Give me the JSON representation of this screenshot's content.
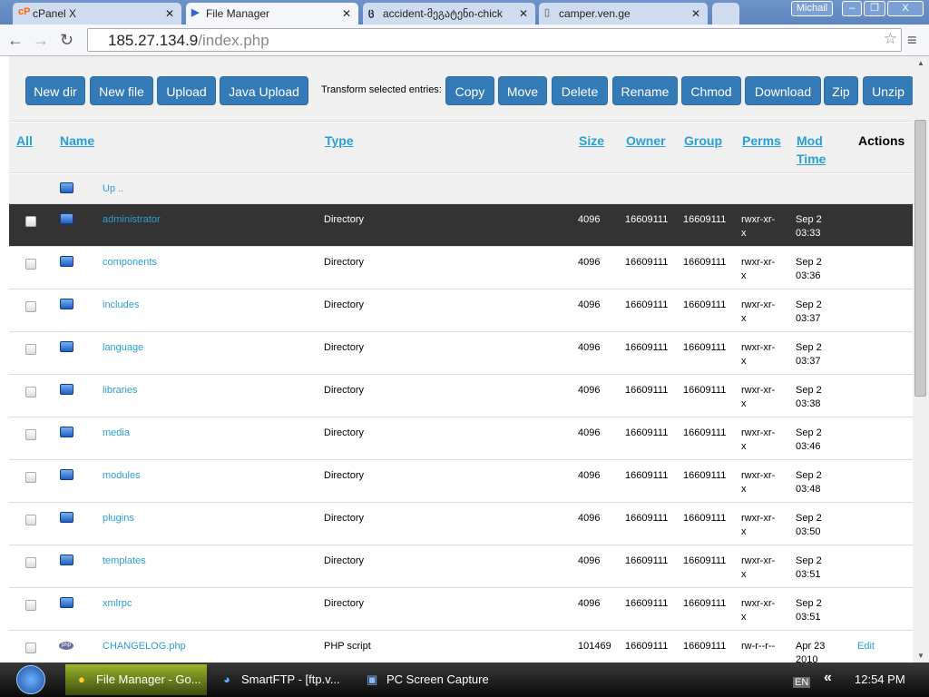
{
  "browser": {
    "tabs": [
      {
        "label": "cPanel X",
        "icon": "cP"
      },
      {
        "label": "File Manager",
        "icon": "▶"
      },
      {
        "label": "accident-მეგატენი-chick",
        "icon": "ც"
      },
      {
        "label": "camper.ven.ge",
        "icon": "▯"
      }
    ],
    "user": "Michail",
    "url_host": "185.27.134.9",
    "url_path": "/index.php"
  },
  "toolbar": {
    "buttons": [
      "New dir",
      "New file",
      "Upload",
      "Java Upload"
    ],
    "transform_label": "Transform selected entries:",
    "actions": [
      "Copy",
      "Move",
      "Delete",
      "Rename",
      "Chmod",
      "Download",
      "Zip",
      "Unzip"
    ]
  },
  "headers": {
    "all": "All",
    "name": "Name",
    "type": "Type",
    "size": "Size",
    "owner": "Owner",
    "group": "Group",
    "perms": "Perms",
    "mod1": "Mod",
    "mod2": "Time",
    "actions": "Actions"
  },
  "up": "Up ..",
  "rows": [
    {
      "name": "administrator",
      "type": "Directory",
      "size": "4096",
      "owner": "16609111",
      "group": "16609111",
      "perms1": "rwxr-xr-",
      "perms2": "x",
      "date": "Sep 2",
      "time": "03:33",
      "action": ""
    },
    {
      "name": "components",
      "type": "Directory",
      "size": "4096",
      "owner": "16609111",
      "group": "16609111",
      "perms1": "rwxr-xr-",
      "perms2": "x",
      "date": "Sep 2",
      "time": "03:36",
      "action": ""
    },
    {
      "name": "includes",
      "type": "Directory",
      "size": "4096",
      "owner": "16609111",
      "group": "16609111",
      "perms1": "rwxr-xr-",
      "perms2": "x",
      "date": "Sep 2",
      "time": "03:37",
      "action": ""
    },
    {
      "name": "language",
      "type": "Directory",
      "size": "4096",
      "owner": "16609111",
      "group": "16609111",
      "perms1": "rwxr-xr-",
      "perms2": "x",
      "date": "Sep 2",
      "time": "03:37",
      "action": ""
    },
    {
      "name": "libraries",
      "type": "Directory",
      "size": "4096",
      "owner": "16609111",
      "group": "16609111",
      "perms1": "rwxr-xr-",
      "perms2": "x",
      "date": "Sep 2",
      "time": "03:38",
      "action": ""
    },
    {
      "name": "media",
      "type": "Directory",
      "size": "4096",
      "owner": "16609111",
      "group": "16609111",
      "perms1": "rwxr-xr-",
      "perms2": "x",
      "date": "Sep 2",
      "time": "03:46",
      "action": ""
    },
    {
      "name": "modules",
      "type": "Directory",
      "size": "4096",
      "owner": "16609111",
      "group": "16609111",
      "perms1": "rwxr-xr-",
      "perms2": "x",
      "date": "Sep 2",
      "time": "03:48",
      "action": ""
    },
    {
      "name": "plugins",
      "type": "Directory",
      "size": "4096",
      "owner": "16609111",
      "group": "16609111",
      "perms1": "rwxr-xr-",
      "perms2": "x",
      "date": "Sep 2",
      "time": "03:50",
      "action": ""
    },
    {
      "name": "templates",
      "type": "Directory",
      "size": "4096",
      "owner": "16609111",
      "group": "16609111",
      "perms1": "rwxr-xr-",
      "perms2": "x",
      "date": "Sep 2",
      "time": "03:51",
      "action": ""
    },
    {
      "name": "xmlrpc",
      "type": "Directory",
      "size": "4096",
      "owner": "16609111",
      "group": "16609111",
      "perms1": "rwxr-xr-",
      "perms2": "x",
      "date": "Sep 2",
      "time": "03:51",
      "action": ""
    },
    {
      "name": "CHANGELOG.php",
      "type": "PHP script",
      "size": "101469",
      "owner": "16609111",
      "group": "16609111",
      "perms1": "rw-r--r--",
      "perms2": "",
      "date": "Apr 23",
      "time": "2010",
      "action": "Edit"
    }
  ],
  "taskbar": {
    "items": [
      "File Manager - Go...",
      "SmartFTP - [ftp.v...",
      "PC Screen Capture"
    ],
    "lang": "EN",
    "clock": "12:54 PM"
  }
}
